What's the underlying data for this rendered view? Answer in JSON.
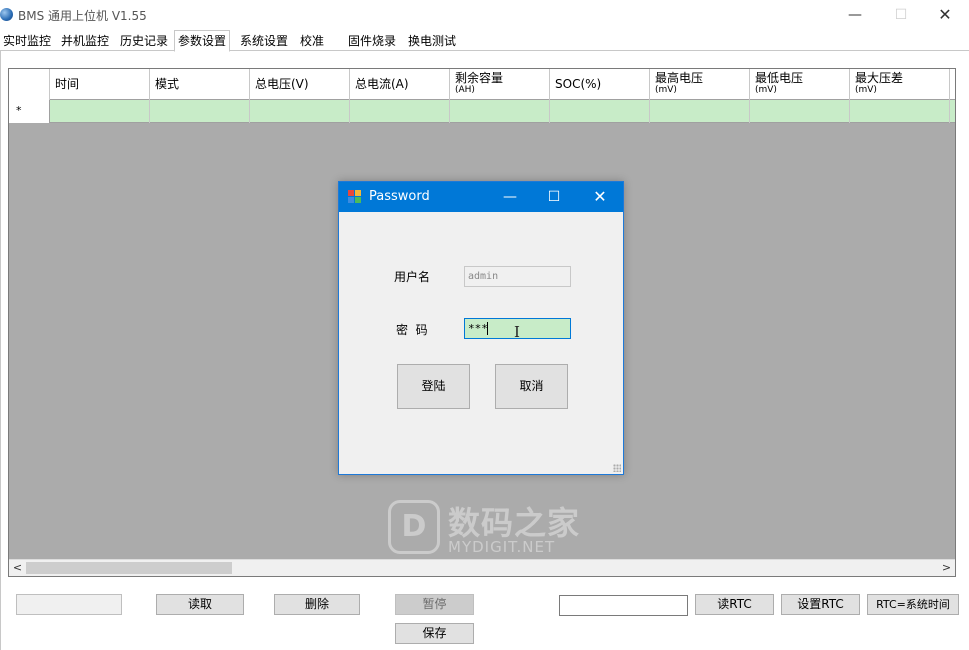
{
  "window": {
    "title": "BMS 通用上位机 V1.55",
    "min_glyph": "—",
    "max_glyph": "☐",
    "close_glyph": "✕"
  },
  "tabs": [
    {
      "label": "实时监控"
    },
    {
      "label": "并机监控"
    },
    {
      "label": "历史记录"
    },
    {
      "label": "参数设置",
      "active": true
    },
    {
      "label": "系统设置"
    },
    {
      "label": "校准"
    },
    {
      "label": "固件烧录"
    },
    {
      "label": "换电测试"
    }
  ],
  "grid": {
    "columns": [
      {
        "line1": "时间",
        "line2": ""
      },
      {
        "line1": "模式",
        "line2": ""
      },
      {
        "line1": "总电压(V)",
        "line2": ""
      },
      {
        "line1": "总电流(A)",
        "line2": ""
      },
      {
        "line1": "剩余容量",
        "line2": "(AH)"
      },
      {
        "line1": "SOC(%)",
        "line2": ""
      },
      {
        "line1": "最高电压",
        "line2": "(mV)"
      },
      {
        "line1": "最低电压",
        "line2": "(mV)"
      },
      {
        "line1": "最大压差",
        "line2": "(mV)"
      }
    ],
    "new_row_marker": "*",
    "row_color": "#c8ecc8",
    "background_color": "#ababab"
  },
  "scrollbar": {
    "left_glyph": "<",
    "right_glyph": ">"
  },
  "watermark": {
    "logo_glyph": "D",
    "cn": "数码之家",
    "en": "MYDIGIT.NET"
  },
  "bottom": {
    "read_label": "读取",
    "delete_label": "删除",
    "pause_label": "暂停",
    "save_label": "保存",
    "rtc_value": "",
    "read_rtc_label": "读RTC",
    "set_rtc_label": "设置RTC",
    "rtc_sync_label": "RTC=系统时间"
  },
  "dialog": {
    "title": "Password",
    "username_label": "用户名",
    "username_value": "admin",
    "password_label": "密  码",
    "password_value": "***",
    "login_label": "登陆",
    "cancel_label": "取消",
    "min_glyph": "—",
    "max_glyph": "☐",
    "close_glyph": "✕",
    "accent_color": "#0078d7"
  }
}
